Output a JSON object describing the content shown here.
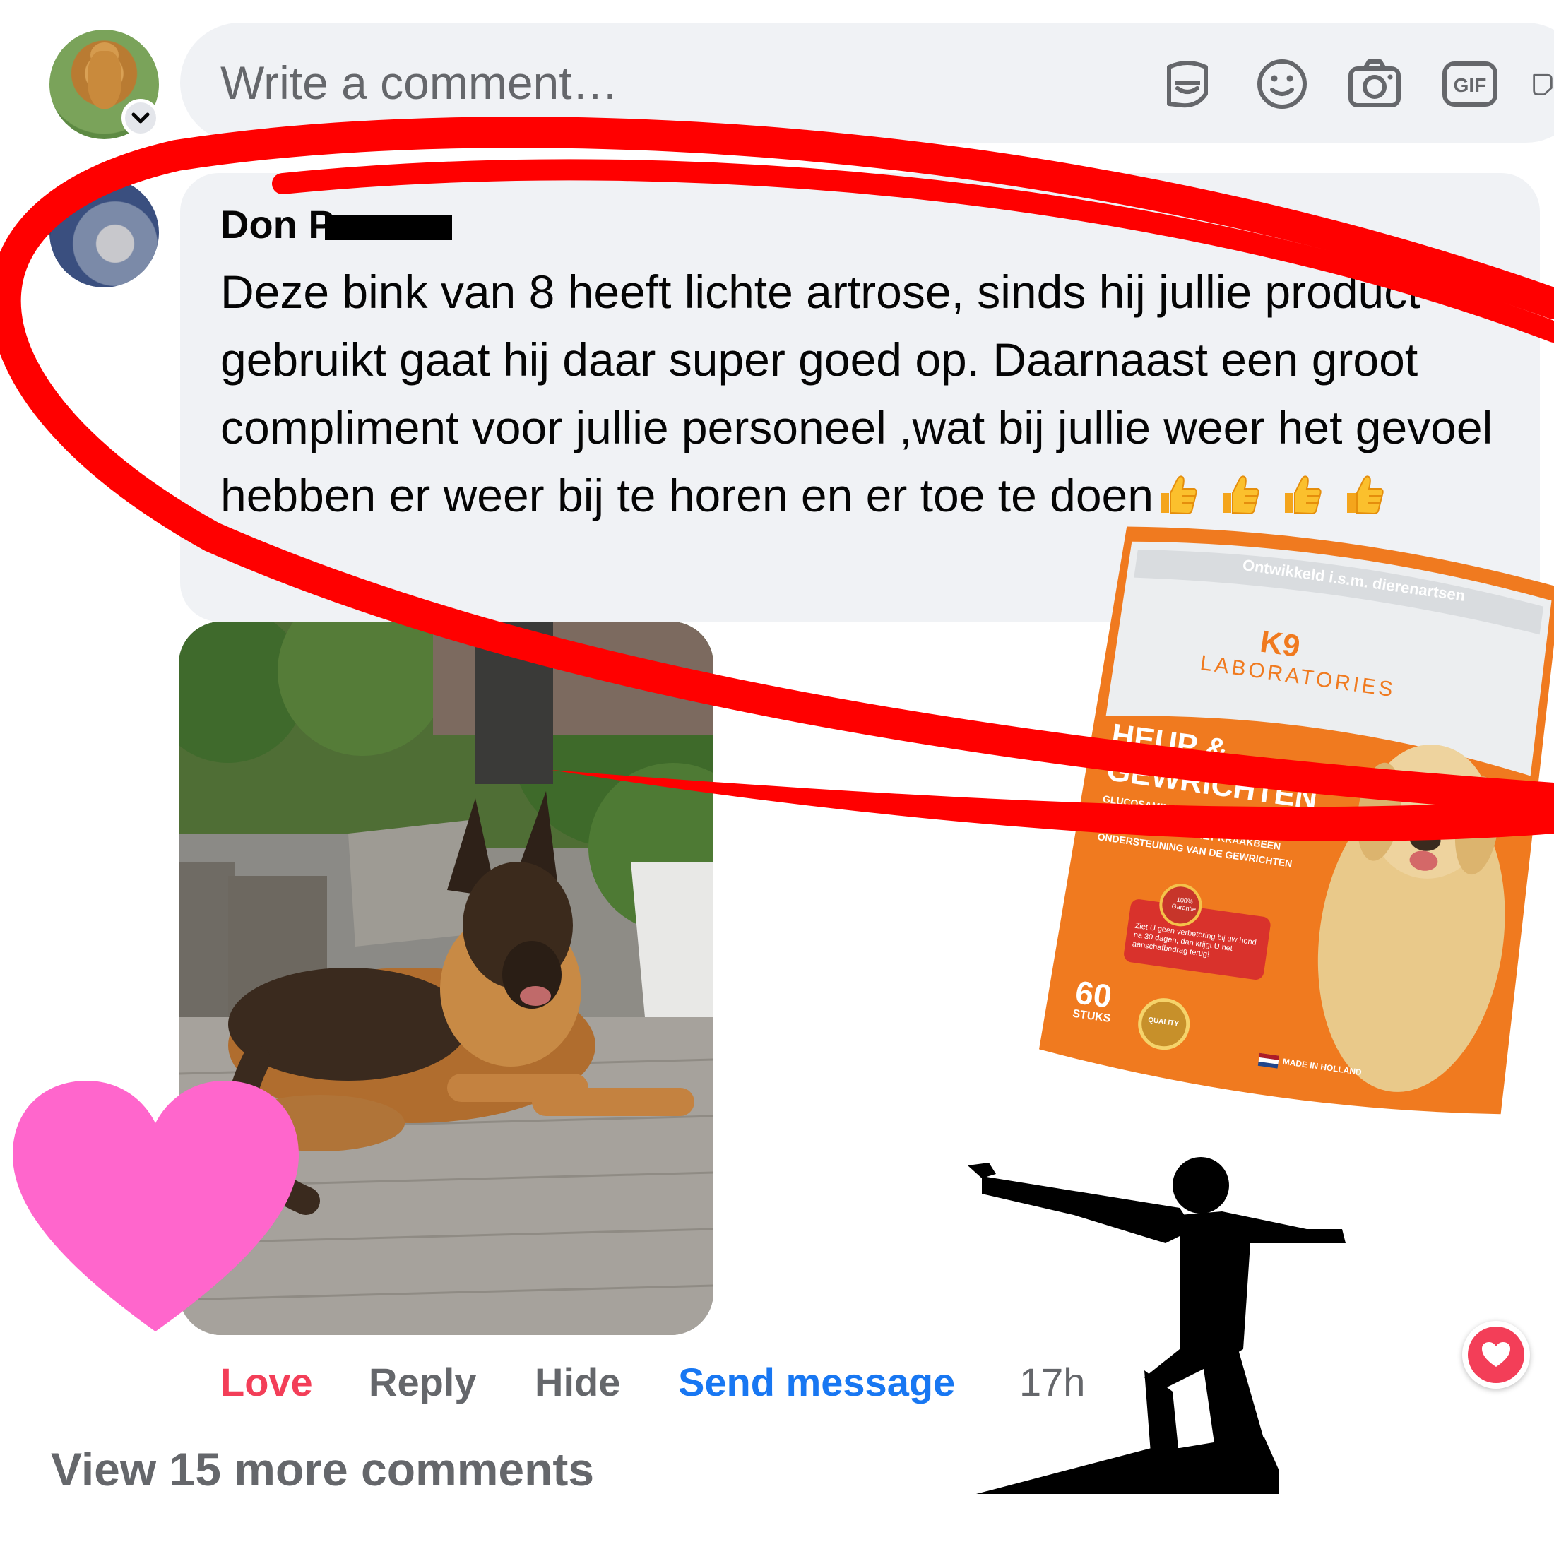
{
  "composer": {
    "placeholder": "Write a comment…",
    "icons": [
      "avatar-sticker-icon",
      "emoji-icon",
      "camera-icon",
      "gif-icon",
      "sticker-icon"
    ]
  },
  "comment": {
    "author": "Don P",
    "text": "Deze bink van 8 heeft lichte artrose, sinds hij jullie product gebruikt gaat hij daar super goed op. Daarnaast een groot compliment voor jullie personeel ,wat bij jullie weer het gevoel hebben er weer bij te horen en er toe te doen",
    "emoji_count": 4
  },
  "actions": {
    "love": "Love",
    "reply": "Reply",
    "hide": "Hide",
    "send_message": "Send message",
    "time": "17h"
  },
  "view_more": "View 15 more comments",
  "product": {
    "banner": "Ontwikkeld i.s.m. dierenartsen",
    "brand": "K9",
    "brand_sub": "LABORATORIES",
    "title_line1": "HEUP &",
    "title_line2": "GEWRICHTEN",
    "ingredients": "GLUCOSAMINE, CHONDROITINE & MSM",
    "benefit1": "VERSTERKING VAN HET KRAAKBEEN",
    "benefit2": "ONDERSTEUNING VAN DE GEWRICHTEN",
    "guarantee_badge": "100% Garantie",
    "guarantee_text": "Ziet U geen verbetering bij uw hond na 30 dagen, dan krijgt U het aanschafbedrag terug!",
    "count": "60",
    "count_unit": "STUKS",
    "quality": "QUALITY",
    "origin": "MADE IN HOLLAND"
  },
  "colors": {
    "love": "#f33e58",
    "link": "#1877f2",
    "muted": "#65676b",
    "bubble": "#f0f2f5",
    "highlight_ring": "#ff0000",
    "heart": "#ff66cc",
    "pouch_orange": "#f07a1f"
  }
}
